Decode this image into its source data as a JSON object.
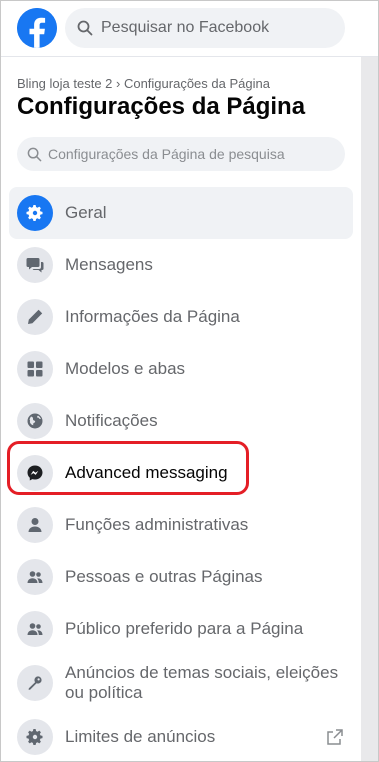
{
  "header": {
    "search_placeholder": "Pesquisar no Facebook"
  },
  "breadcrumb": "Bling loja teste 2 › Configurações da Página",
  "page_title": "Configurações da Página",
  "settings_search_placeholder": "Configurações da Página de pesquisa",
  "menu": [
    {
      "label": "Geral",
      "icon": "gear-icon"
    },
    {
      "label": "Mensagens",
      "icon": "chat-bubbles-icon"
    },
    {
      "label": "Informações da Página",
      "icon": "pencil-icon"
    },
    {
      "label": "Modelos e abas",
      "icon": "grid-icon"
    },
    {
      "label": "Notificações",
      "icon": "globe-icon"
    },
    {
      "label": "Advanced messaging",
      "icon": "messenger-icon"
    },
    {
      "label": "Funções administrativas",
      "icon": "person-icon"
    },
    {
      "label": "Pessoas e outras Páginas",
      "icon": "people-icon"
    },
    {
      "label": "Público preferido para a Página",
      "icon": "people-icon"
    },
    {
      "label": "Anúncios de temas sociais, eleições ou política",
      "icon": "key-icon"
    },
    {
      "label": "Limites de anúncios",
      "icon": "gear-icon"
    }
  ],
  "colors": {
    "brand": "#1877f2",
    "highlight": "#e41e26"
  }
}
